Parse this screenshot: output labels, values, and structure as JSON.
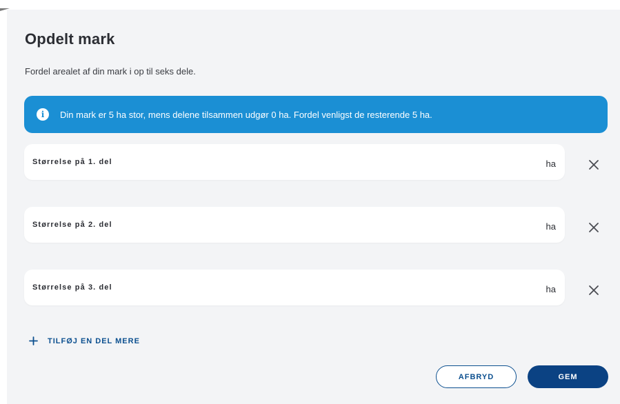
{
  "dialog": {
    "title": "Opdelt mark",
    "subtitle": "Fordel arealet af din mark i op til seks dele.",
    "info": {
      "icon": "info-icon",
      "icon_glyph": "i",
      "text": "Din mark er 5 ha stor, mens delene tilsammen udgør 0 ha. Fordel venligst de resterende 5 ha."
    },
    "parts": [
      {
        "label": "Størrelse på 1. del",
        "value": "",
        "unit": "ha"
      },
      {
        "label": "Størrelse på 2. del",
        "value": "",
        "unit": "ha"
      },
      {
        "label": "Størrelse på 3. del",
        "value": "",
        "unit": "ha"
      }
    ],
    "add_part_label": "TILFØJ EN DEL MERE",
    "cancel_label": "AFBRYD",
    "save_label": "GEM"
  },
  "colors": {
    "banner": "#1b8fd4",
    "primary": "#0b4283",
    "background": "#f3f4f6"
  }
}
